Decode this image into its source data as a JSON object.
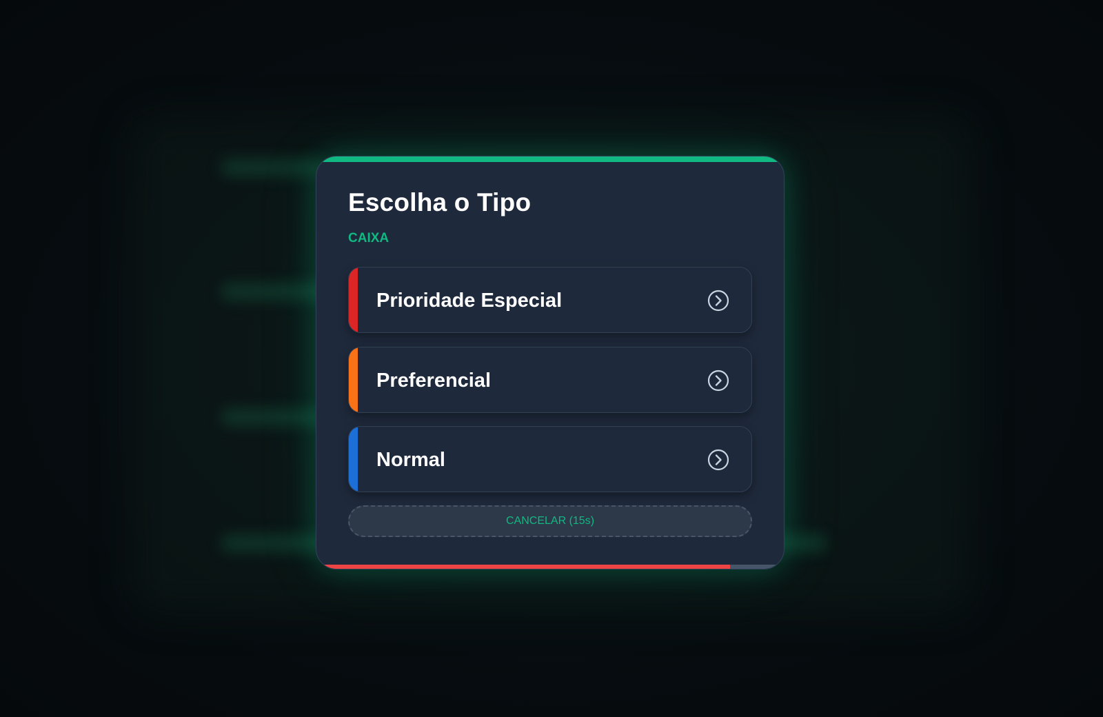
{
  "modal": {
    "title": "Escolha o Tipo",
    "subtitle": "CAIXA",
    "accent_color": "#10b981",
    "options": [
      {
        "label": "Prioridade Especial",
        "color": "#dc2626",
        "icon": "chevron-right-circle-icon"
      },
      {
        "label": "Preferencial",
        "color": "#f97316",
        "icon": "chevron-right-circle-icon"
      },
      {
        "label": "Normal",
        "color": "#1d6fd8",
        "icon": "chevron-right-circle-icon"
      }
    ],
    "cancel_label": "CANCELAR (15s)",
    "timer": {
      "remaining_fraction": 0.885,
      "color": "#ef4444"
    }
  }
}
